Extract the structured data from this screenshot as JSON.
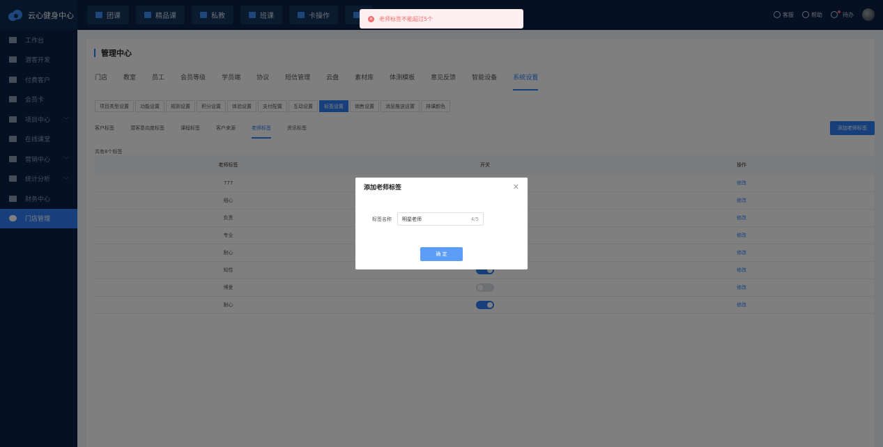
{
  "app": {
    "name": "云心健身中心"
  },
  "sidebar": {
    "items": [
      {
        "label": "工作台",
        "icon": "monitor-icon",
        "chevron": false
      },
      {
        "label": "潜客开发",
        "icon": "id-card-icon",
        "chevron": false
      },
      {
        "label": "付费客户",
        "icon": "users-icon",
        "chevron": false
      },
      {
        "label": "会员卡",
        "icon": "card-icon",
        "chevron": false
      },
      {
        "label": "项目中心",
        "icon": "project-icon",
        "chevron": true
      },
      {
        "label": "在线课堂",
        "icon": "video-icon",
        "chevron": false
      },
      {
        "label": "营销中心",
        "icon": "tag-icon",
        "chevron": true
      },
      {
        "label": "统计分析",
        "icon": "pie-icon",
        "chevron": true
      },
      {
        "label": "财务中心",
        "icon": "wallet-icon",
        "chevron": false
      },
      {
        "label": "门店管理",
        "icon": "store-icon",
        "chevron": false,
        "active": true
      }
    ]
  },
  "topnav": {
    "items": [
      "团课",
      "精品课",
      "私教",
      "班课",
      "卡操作",
      ""
    ],
    "right": {
      "service": "客服",
      "help": "帮助",
      "todo": "待办"
    }
  },
  "toast": {
    "message": "老师标签不能超过5个",
    "color": "#f56c6c"
  },
  "page": {
    "title": "管理中心"
  },
  "tabs": [
    "门店",
    "教室",
    "员工",
    "会员等级",
    "学员端",
    "协议",
    "短信管理",
    "云盘",
    "素材库",
    "体测模板",
    "意见反馈",
    "智能设备",
    "系统设置"
  ],
  "active_tab": "系统设置",
  "subtabs": [
    "项目类型设置",
    "功能设置",
    "规则设置",
    "积分设置",
    "体验设置",
    "支付配置",
    "互动设置",
    "标签设置",
    "销售设置",
    "消息推送设置",
    "排课颜色"
  ],
  "active_subtab": "标签设置",
  "label_tabs": [
    "客户标签",
    "潜客意向度标签",
    "课程标签",
    "客户来源",
    "老师标签",
    "资讯标签"
  ],
  "active_label_tab": "老师标签",
  "add_button": "添加老师标签",
  "count_text": "共有8个标签",
  "table": {
    "headers": {
      "name": "老师标签",
      "switch": "开关",
      "op": "操作"
    },
    "rows": [
      {
        "name": "777",
        "on": true,
        "op": "修改"
      },
      {
        "name": "细心",
        "on": true,
        "op": "修改"
      },
      {
        "name": "负责",
        "on": true,
        "op": "修改"
      },
      {
        "name": "专业",
        "on": true,
        "op": "修改"
      },
      {
        "name": "耐心",
        "on": true,
        "op": "修改"
      },
      {
        "name": "知性",
        "on": true,
        "op": "修改"
      },
      {
        "name": "博爱",
        "on": false,
        "op": "修改"
      },
      {
        "name": "耐心",
        "on": true,
        "op": "修改"
      }
    ]
  },
  "dialog": {
    "title": "添加老师标签",
    "field_label": "标签名称",
    "field_value": "明星老师",
    "field_count": "4/5",
    "confirm": "确 定"
  },
  "colors": {
    "accent": "#2d7ff9",
    "sidebar_bg": "#0a2347",
    "error": "#f56c6c"
  }
}
